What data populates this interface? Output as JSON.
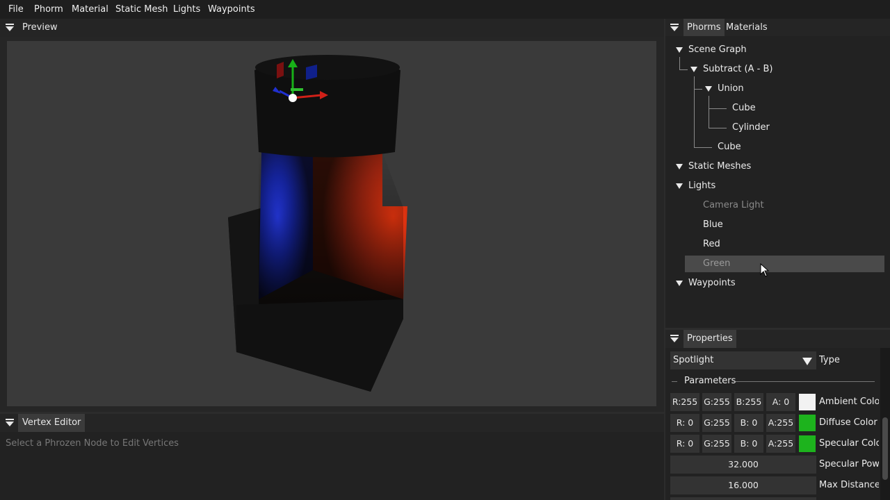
{
  "menu": [
    "File",
    "Phorm",
    "Material",
    "Static Mesh",
    "Lights",
    "Waypoints"
  ],
  "preview": {
    "title": "Preview"
  },
  "vertex_editor": {
    "title": "Vertex Editor",
    "hint": "Select a Phrozen Node to Edit Vertices"
  },
  "right_tabs": {
    "phorms": "Phorms",
    "materials": "Materials"
  },
  "tree": {
    "scene_graph": "Scene Graph",
    "subtract": "Subtract (A - B)",
    "union": "Union",
    "cube1": "Cube",
    "cylinder": "Cylinder",
    "cube2": "Cube",
    "static_meshes": "Static Meshes",
    "lights": "Lights",
    "light_items": [
      "Camera Light",
      "Blue",
      "Red",
      "Green"
    ],
    "waypoints": "Waypoints"
  },
  "properties": {
    "title": "Properties",
    "type_value": "Spotlight",
    "type_label": "Type",
    "section": "Parameters",
    "ambient": {
      "r": "R:255",
      "g": "G:255",
      "b": "B:255",
      "a": "A:  0",
      "label": "Ambient Color",
      "swatch": "#f2f2f2"
    },
    "diffuse": {
      "r": "R:  0",
      "g": "G:255",
      "b": "B:  0",
      "a": "A:255",
      "label": "Diffuse Color",
      "swatch": "#1db31d"
    },
    "specular": {
      "r": "R:  0",
      "g": "G:255",
      "b": "B:  0",
      "a": "A:255",
      "label": "Specular Color",
      "swatch": "#1db31d"
    },
    "specular_power": {
      "value": "32.000",
      "label": "Specular Power"
    },
    "max_distance": {
      "value": "16.000",
      "label": "Max Distance"
    }
  },
  "colors": {
    "blue_light": "#1d35ff",
    "red_light": "#ff3a10",
    "green_light": "#1db31d"
  }
}
